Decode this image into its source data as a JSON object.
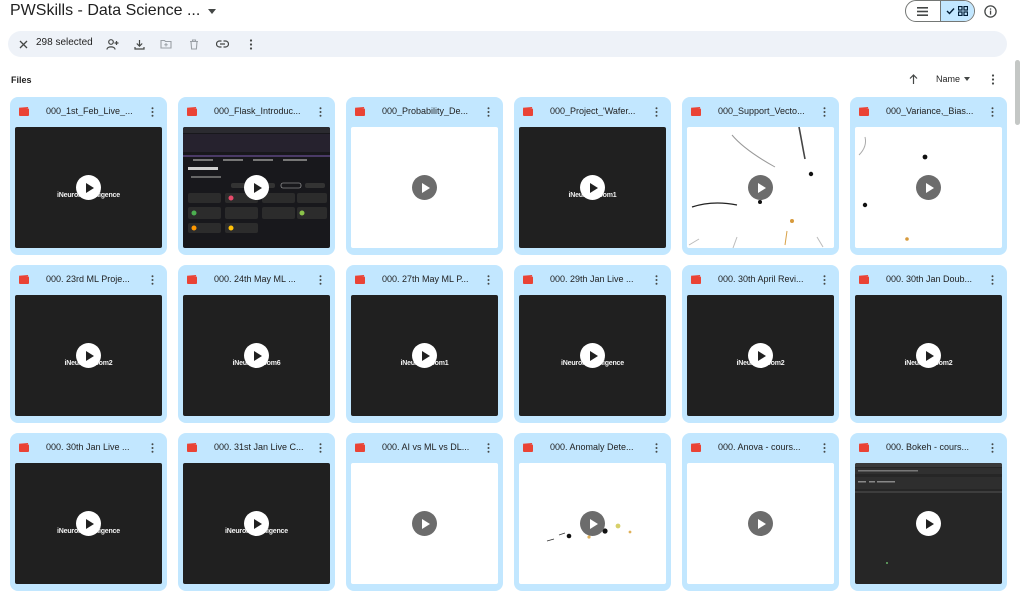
{
  "header": {
    "title": "PWSkills - Data Science ..."
  },
  "selection_bar": {
    "count_text": "298 selected"
  },
  "files_section": {
    "label": "Files",
    "sort_label": "Name"
  },
  "files": [
    {
      "name": "000_1st_Feb_Live_...",
      "thumb_brand": "iNeuron intelligence"
    },
    {
      "name": "000_Flask_Introduc...",
      "thumb_brand": ""
    },
    {
      "name": "000_Probability_De...",
      "thumb_brand": ""
    },
    {
      "name": "000_Project_'Wafer...",
      "thumb_brand": "iNeuron zoom1"
    },
    {
      "name": "000_Support_Vecto...",
      "thumb_brand": ""
    },
    {
      "name": "000_Variance,_Bias...",
      "thumb_brand": ""
    },
    {
      "name": "000. 23rd ML Proje...",
      "thumb_brand": "iNeuron zoom2"
    },
    {
      "name": "000. 24th May ML ...",
      "thumb_brand": "iNeuron zoom6"
    },
    {
      "name": "000. 27th May ML P...",
      "thumb_brand": "iNeuron zoom1"
    },
    {
      "name": "000. 29th Jan Live ...",
      "thumb_brand": "iNeuron intelligence"
    },
    {
      "name": "000. 30th April Revi...",
      "thumb_brand": "iNeuron zoom2"
    },
    {
      "name": "000. 30th Jan Doub...",
      "thumb_brand": "iNeuron zoom2"
    },
    {
      "name": "000. 30th Jan Live ...",
      "thumb_brand": "iNeuron intelligence"
    },
    {
      "name": "000. 31st Jan Live C...",
      "thumb_brand": "iNeuron intelligence"
    },
    {
      "name": "000. AI vs ML vs DL...",
      "thumb_brand": ""
    },
    {
      "name": "000. Anomaly Dete...",
      "thumb_brand": ""
    },
    {
      "name": "000. Anova - cours...",
      "thumb_brand": ""
    },
    {
      "name": "000. Bokeh - cours...",
      "thumb_brand": ""
    }
  ],
  "colors": {
    "card_bg": "#c2e7ff",
    "video_icon": "#ea4335",
    "selection_bar_bg": "#eef2f8"
  },
  "icons": {
    "close": "close-icon",
    "share": "add-person-icon",
    "download": "download-icon",
    "move": "move-to-folder-icon",
    "trash": "trash-icon",
    "link": "link-icon",
    "more": "more-vert-icon",
    "list_view": "list-view-icon",
    "grid_view": "grid-view-icon",
    "info": "info-icon",
    "sort_dir": "arrow-up-icon",
    "file_type": "video-file-icon",
    "play": "play-icon"
  }
}
